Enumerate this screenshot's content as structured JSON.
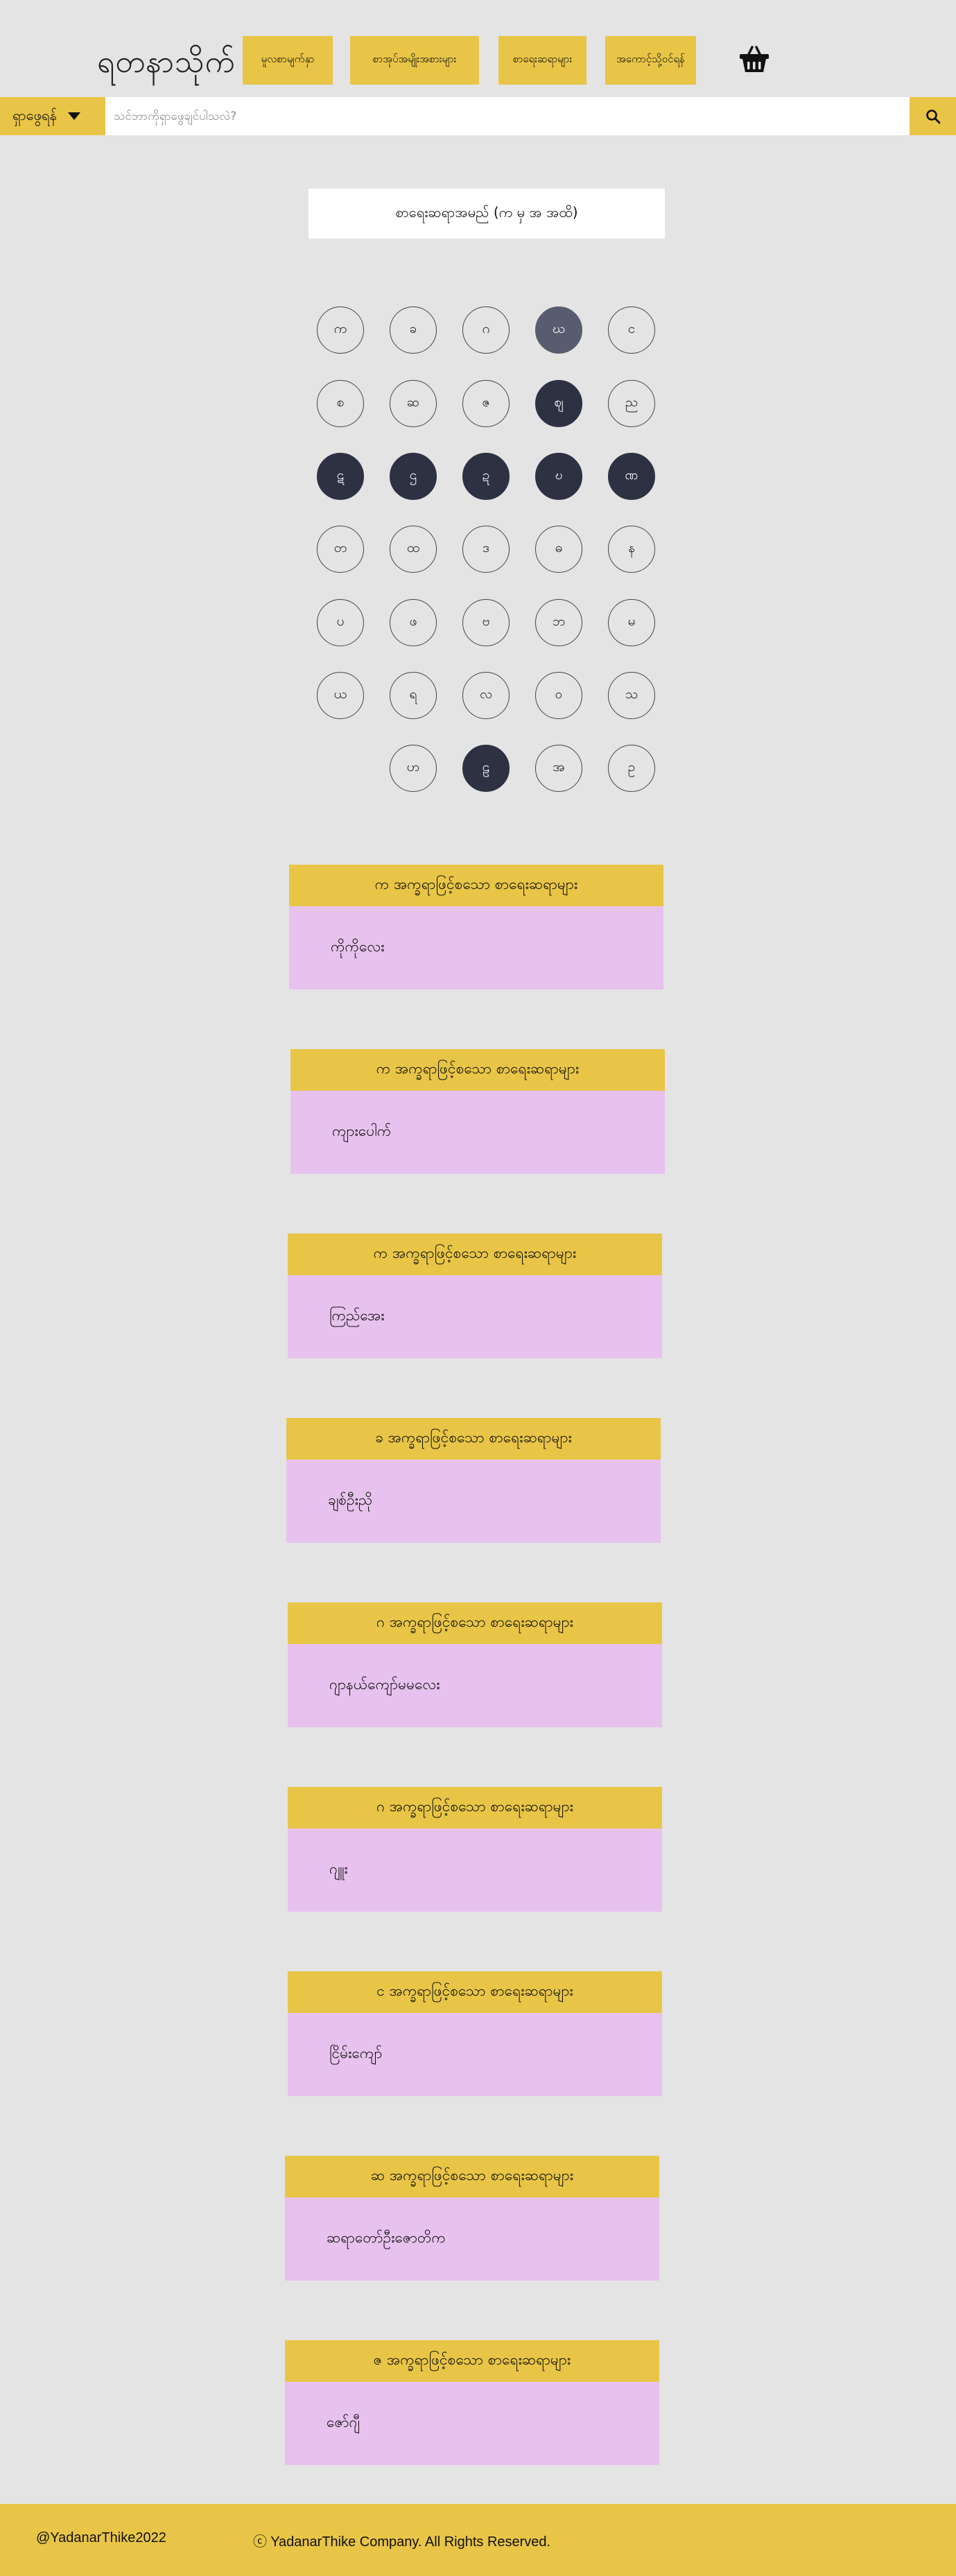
{
  "header": {
    "logo": "ရတနာသိုက်",
    "nav": [
      {
        "label": "မူလစာမျက်နှာ"
      },
      {
        "label": "စာအုပ်အမျိုးအစားများ"
      },
      {
        "label": "စာရေးဆရာများ"
      },
      {
        "label": "အကောင့်သို့ဝင်ရန်"
      }
    ],
    "cart_icon": "basket-icon"
  },
  "search": {
    "dropdown_label": "ရှာဖွေရန်",
    "placeholder": "သင်ဘာကိုရှာဖွေချင်ပါသလဲ?",
    "value": "",
    "button_icon": "search-icon"
  },
  "title": "စာရေးဆရာအမည် (က မှ အ အထိ)",
  "letters": [
    {
      "char": "က",
      "state": "normal"
    },
    {
      "char": "ခ",
      "state": "normal"
    },
    {
      "char": "ဂ",
      "state": "normal"
    },
    {
      "char": "ဃ",
      "state": "mid"
    },
    {
      "char": "င",
      "state": "normal"
    },
    {
      "char": "စ",
      "state": "normal"
    },
    {
      "char": "ဆ",
      "state": "normal"
    },
    {
      "char": "ဇ",
      "state": "normal"
    },
    {
      "char": "ဈ",
      "state": "dark"
    },
    {
      "char": "ည",
      "state": "normal"
    },
    {
      "char": "ဋ",
      "state": "dark"
    },
    {
      "char": "ဌ",
      "state": "dark"
    },
    {
      "char": "ဍ",
      "state": "dark"
    },
    {
      "char": "ဎ",
      "state": "dark"
    },
    {
      "char": "ဏ",
      "state": "dark"
    },
    {
      "char": "တ",
      "state": "normal"
    },
    {
      "char": "ထ",
      "state": "normal"
    },
    {
      "char": "ဒ",
      "state": "normal"
    },
    {
      "char": "ဓ",
      "state": "normal"
    },
    {
      "char": "န",
      "state": "normal"
    },
    {
      "char": "ပ",
      "state": "normal"
    },
    {
      "char": "ဖ",
      "state": "normal"
    },
    {
      "char": "ဗ",
      "state": "normal"
    },
    {
      "char": "ဘ",
      "state": "normal"
    },
    {
      "char": "မ",
      "state": "normal"
    },
    {
      "char": "ယ",
      "state": "normal"
    },
    {
      "char": "ရ",
      "state": "normal"
    },
    {
      "char": "လ",
      "state": "normal"
    },
    {
      "char": "ဝ",
      "state": "normal"
    },
    {
      "char": "သ",
      "state": "normal"
    },
    {
      "char": "ဟ",
      "state": "normal"
    },
    {
      "char": "ဠ",
      "state": "dark"
    },
    {
      "char": "အ",
      "state": "normal"
    },
    {
      "char": "ဥ",
      "state": "normal"
    }
  ],
  "authors": [
    {
      "heading": "က အက္ခရာဖြင့်စသော စာရေးဆရာများ",
      "name": "ကိုကိုလေး"
    },
    {
      "heading": "က အက္ခရာဖြင့်စသော စာရေးဆရာများ",
      "name": "ကျားပေါက်"
    },
    {
      "heading": "က အက္ခရာဖြင့်စသော စာရေးဆရာများ",
      "name": "ကြည်အေး"
    },
    {
      "heading": "ခ အက္ခရာဖြင့်စသော စာရေးဆရာများ",
      "name": "ချစ်ဦးညို"
    },
    {
      "heading": "ဂ အက္ခရာဖြင့်စသော စာရေးဆရာများ",
      "name": "ဂျာနယ်ကျော်မမလေး"
    },
    {
      "heading": "ဂ အက္ခရာဖြင့်စသော စာရေးဆရာများ",
      "name": "ဂျူး"
    },
    {
      "heading": "င အက္ခရာဖြင့်စသော စာရေးဆရာများ",
      "name": "ငြိမ်းကျော်"
    },
    {
      "heading": "ဆ အက္ခရာဖြင့်စသော စာရေးဆရာများ",
      "name": "ဆရာတော်ဦးဇောတိက"
    },
    {
      "heading": "ဇ အက္ခရာဖြင့်စသော စာရေးဆရာများ",
      "name": "ဇော်ဂျီ"
    }
  ],
  "footer": {
    "handle": "@YadanarThike2022",
    "copyright": "ⓒ YadanarThike Company. All Rights Reserved."
  },
  "colors": {
    "accent": "#e9c547",
    "card_body": "#e8c2ee",
    "letter_dark": "#2e3142",
    "letter_mid": "#595c6f",
    "background": "#e4e4e4"
  }
}
